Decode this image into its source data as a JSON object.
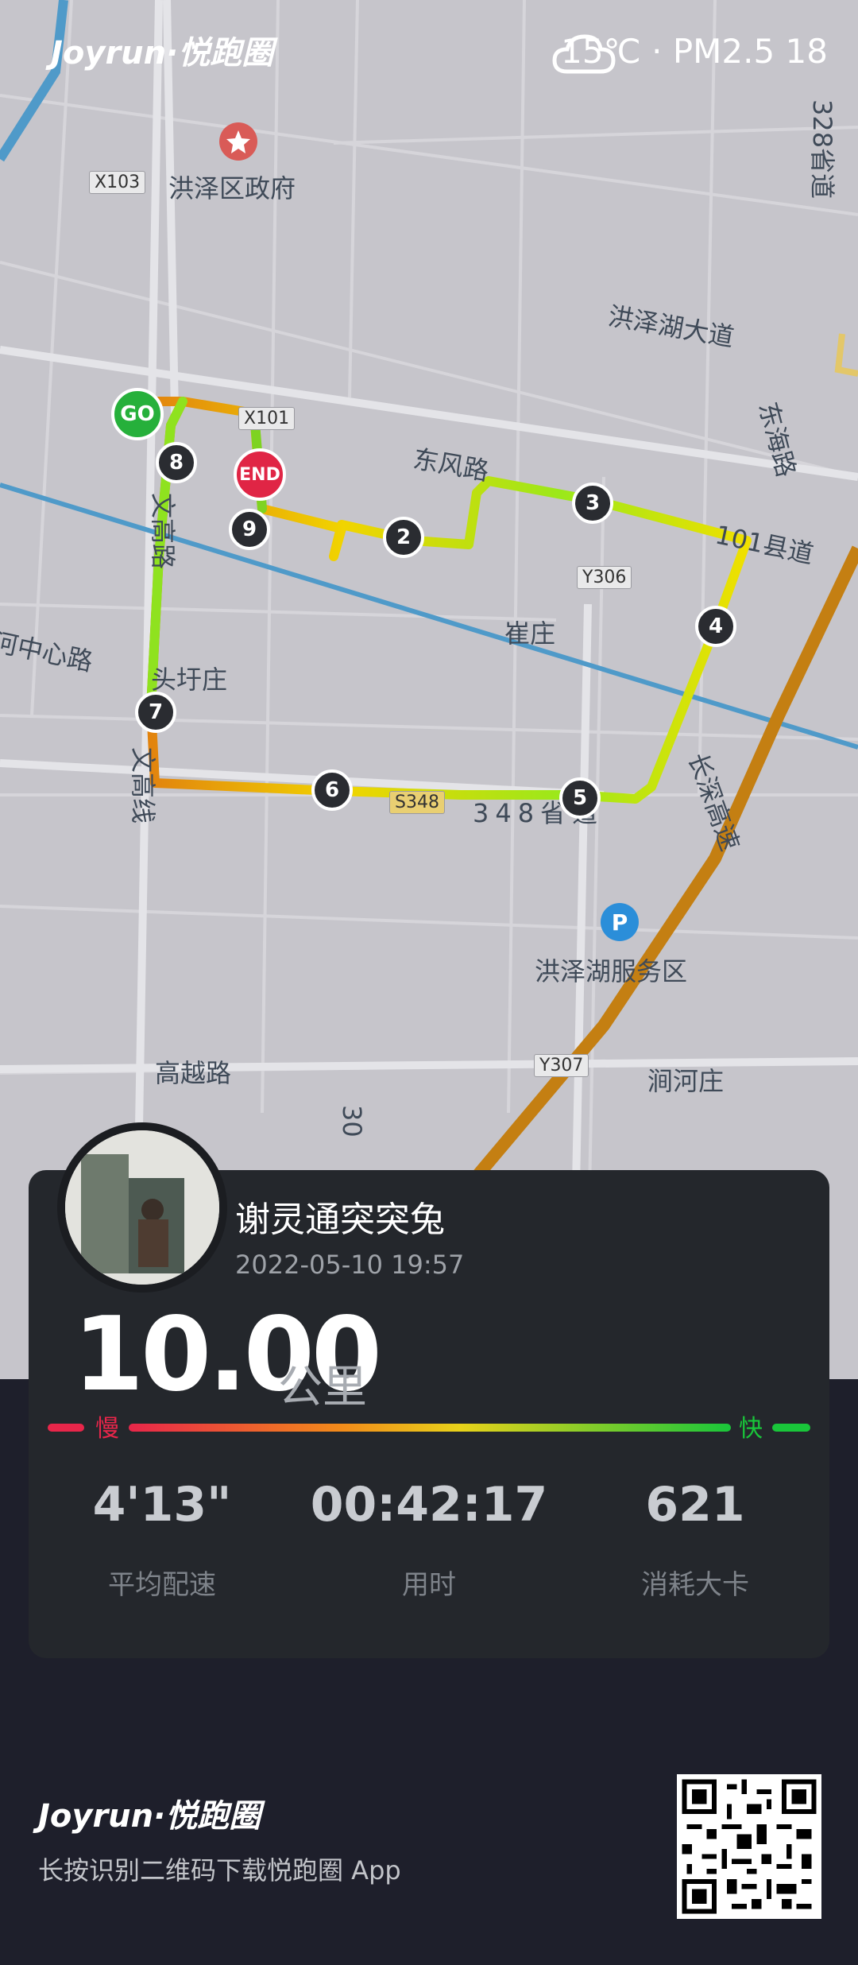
{
  "header": {
    "logo": "Joyrun·悦跑圈",
    "weather": "15℃ · PM2.5 18",
    "weather_icon": "cloud-icon"
  },
  "map": {
    "places": [
      "洪泽区政府",
      "洪泽湖大道",
      "东风路",
      "崔庄",
      "河中心路",
      "头圩庄",
      "洪泽湖服务区",
      "高越路",
      "涧河庄",
      "长深高速",
      "东海路",
      "101县道",
      "328省道",
      "348省道",
      "文高路",
      "文高线",
      "30"
    ],
    "road_tags": [
      "X103",
      "X101",
      "Y306",
      "S348",
      "Y307"
    ],
    "markers": {
      "start": "GO",
      "end": "END",
      "km": [
        "2",
        "3",
        "4",
        "5",
        "6",
        "7",
        "8",
        "9"
      ]
    }
  },
  "run": {
    "user": "谢灵通突突兔",
    "datetime": "2022-05-10 19:57",
    "distance": "10.00",
    "unit": "公里",
    "pace_slow": "慢",
    "pace_fast": "快",
    "stats": [
      {
        "value": "4'13\"",
        "label": "平均配速"
      },
      {
        "value": "00:42:17",
        "label": "用时"
      },
      {
        "value": "621",
        "label": "消耗大卡"
      }
    ]
  },
  "footer": {
    "logo": "Joyrun·悦跑圈",
    "tagline": "长按识别二维码下载悦跑圈 App"
  },
  "colors": {
    "slow": "#e8264a",
    "fast": "#19c63a",
    "card": "#24272c",
    "background": "#1e1f2b"
  }
}
